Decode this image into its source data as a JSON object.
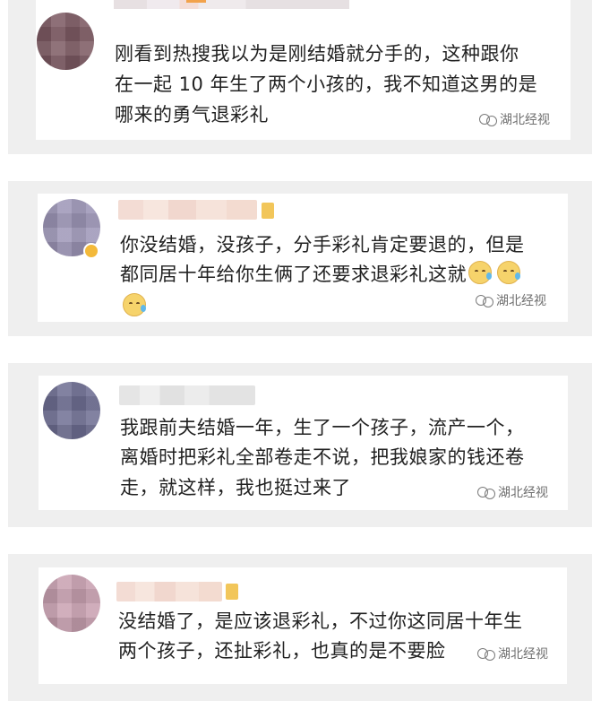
{
  "comments": [
    {
      "text_lines": [
        "刚看到热搜我以为是刚结婚就分手的，这种跟你",
        "在一起 10 年生了两个小孩的，我不知道这男的是",
        "哪来的勇气退彩礼"
      ]
    },
    {
      "text_lines": [
        "你没结婚，没孩子，分手彩礼肯定要退的，但是",
        "都同居十年给你生俩了还要求退彩礼这就"
      ]
    },
    {
      "text_lines": [
        "我跟前夫结婚一年，生了一个孩子，流产一个，",
        "离婚时把彩礼全部卷走不说，把我娘家的钱还卷",
        "走，就这样，我也挺过来了"
      ]
    },
    {
      "text_lines": [
        "没结婚了，是应该退彩礼，不过你这同居十年生",
        "两个孩子，还扯彩礼，也真的是不要脸"
      ]
    }
  ],
  "watermark": {
    "text": "湖北经视",
    "icon": "camera-rings-icon"
  },
  "emoji_name": "sweat-face-icon",
  "colors": {
    "band": "#efefef",
    "card": "#ffffff",
    "text": "#222222",
    "watermark": "#6f6f6f"
  }
}
